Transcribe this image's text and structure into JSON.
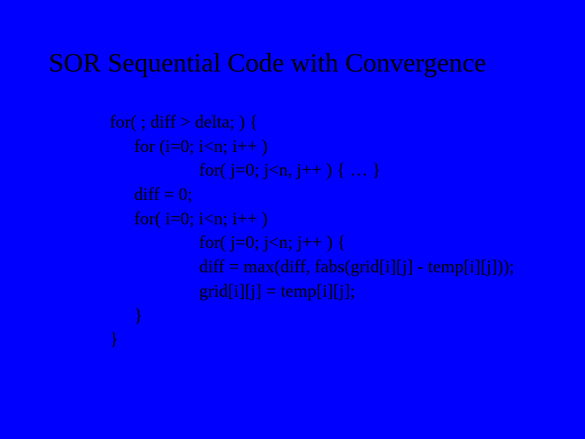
{
  "title": "SOR Sequential Code with Convergence",
  "code": {
    "l1": "for( ; diff > delta; ) {",
    "l2": "for (i=0; i<n; i++ )",
    "l3": "for( j=0; j<n, j++ ) { … }",
    "l4": "diff = 0;",
    "l5": "for( i=0; i<n; i++ )",
    "l6": "for( j=0; j<n; j++ ) {",
    "l7": "diff = max(diff, fabs(grid[i][j] - temp[i][j]));",
    "l8": "grid[i][j] = temp[i][j];",
    "l9": "}",
    "l10": "}"
  }
}
